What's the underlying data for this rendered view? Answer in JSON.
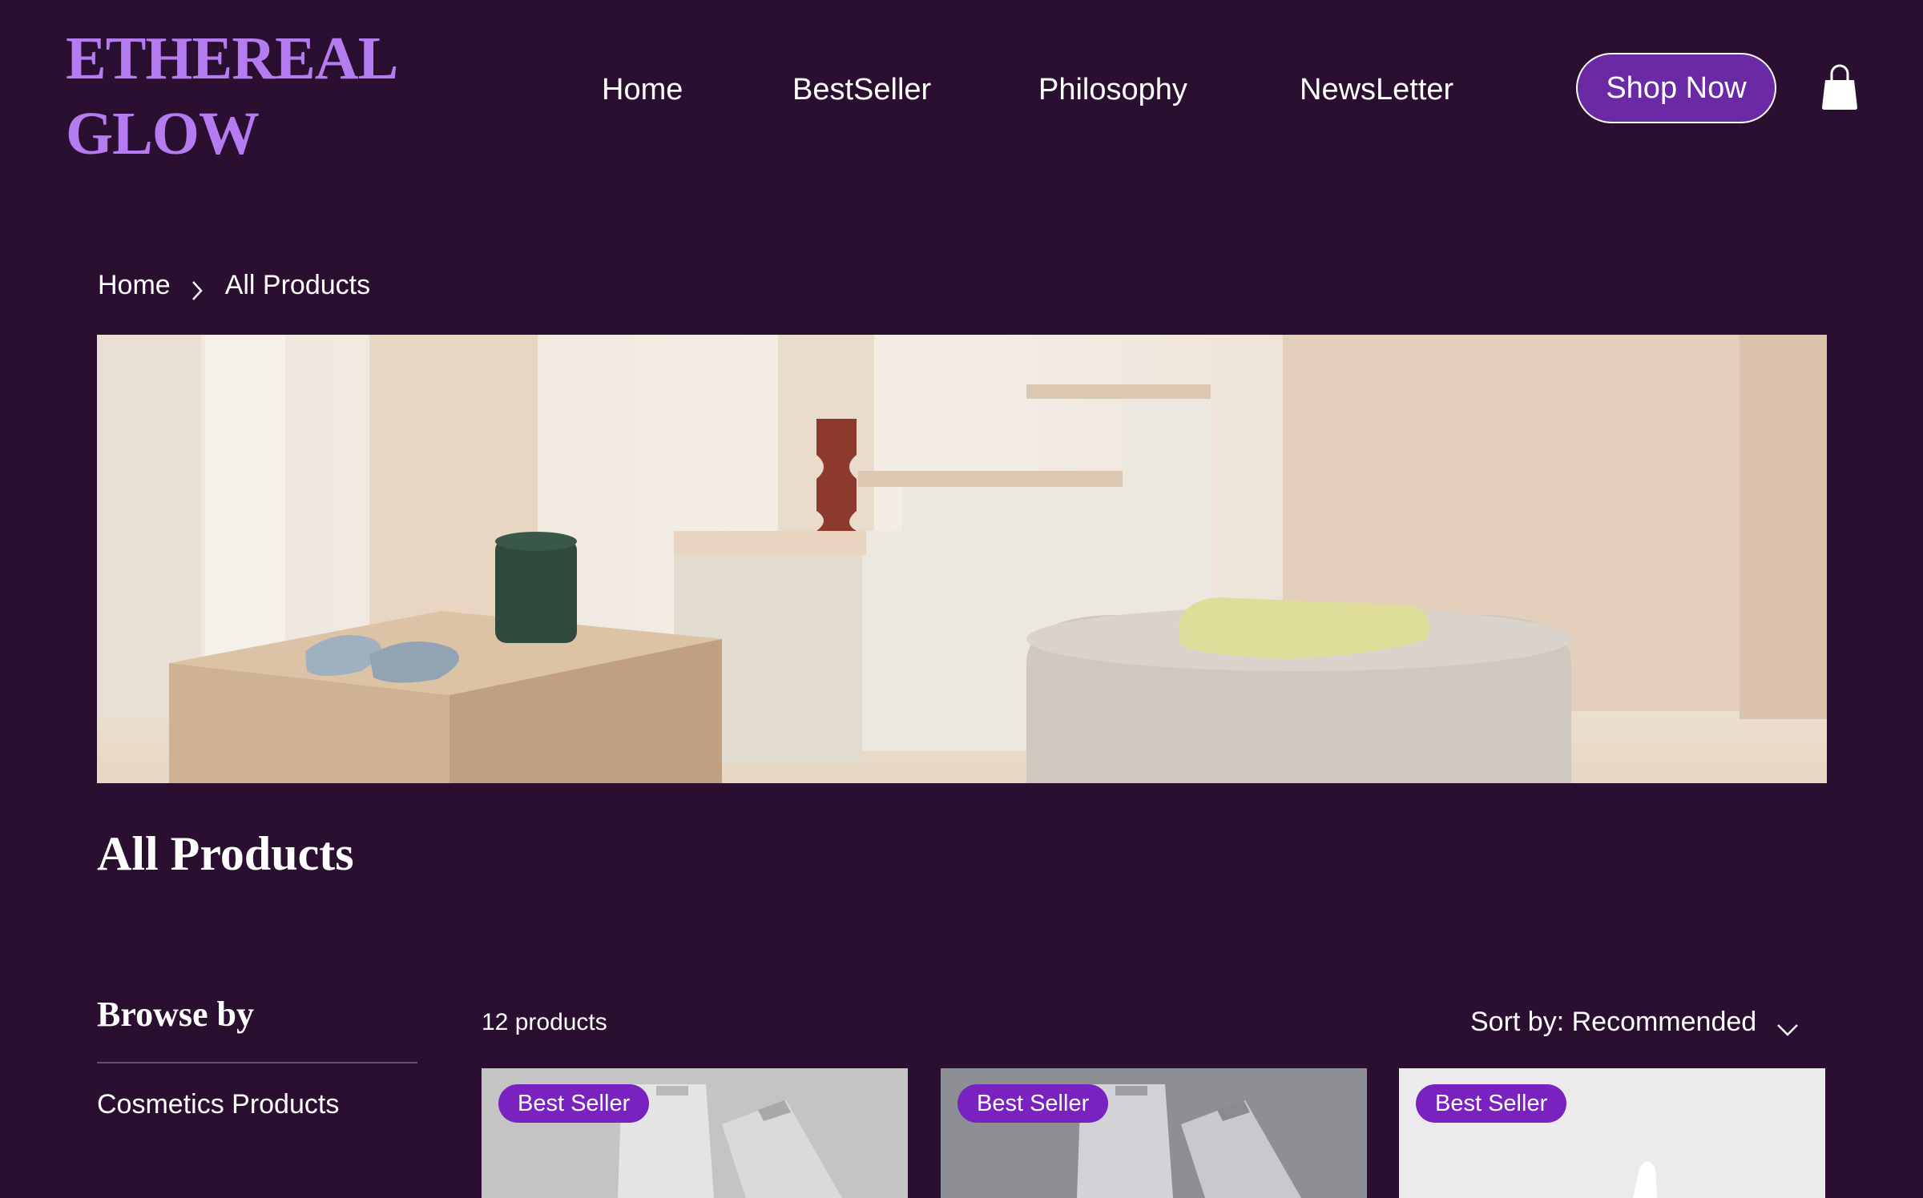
{
  "brand": {
    "line1": "ETHEREAL",
    "line2": "GLOW"
  },
  "nav": {
    "items": [
      {
        "label": "Home"
      },
      {
        "label": "BestSeller"
      },
      {
        "label": "Philosophy"
      },
      {
        "label": "NewsLetter"
      }
    ],
    "shop_now": "Shop Now",
    "cart_icon": "shopping-bag-icon"
  },
  "breadcrumb": {
    "home": "Home",
    "current": "All Products",
    "separator_icon": "chevron-right-icon"
  },
  "page": {
    "title": "All Products"
  },
  "sidebar": {
    "title": "Browse by",
    "items": [
      {
        "label": "Cosmetics Products"
      }
    ]
  },
  "products": {
    "count_text": "12 products",
    "sort_label": "Sort by: Recommended",
    "sort_icon": "chevron-down-icon",
    "cards": [
      {
        "badge": "Best Seller"
      },
      {
        "badge": "Best Seller"
      },
      {
        "badge": "Best Seller"
      }
    ]
  },
  "colors": {
    "background": "#2a0f31",
    "brand": "#b57bf0",
    "button": "#6a2aa6",
    "badge": "#7a22c0"
  }
}
